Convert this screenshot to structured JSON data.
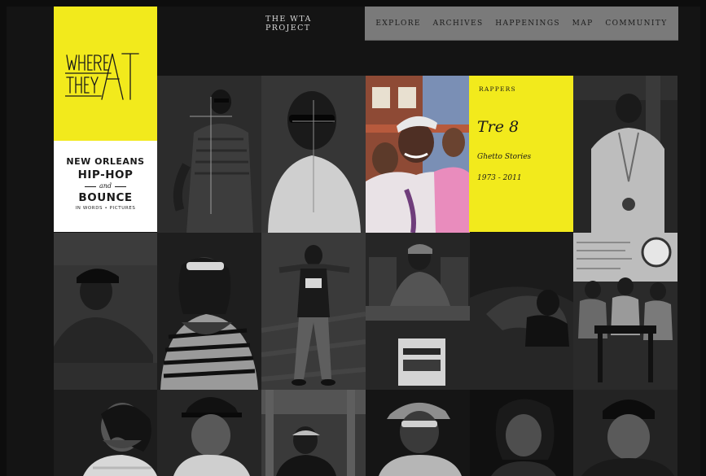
{
  "nav": {
    "project": "THE WTA PROJECT",
    "items": [
      "EXPLORE",
      "ARCHIVES",
      "HAPPENINGS",
      "MAP",
      "COMMUNITY"
    ]
  },
  "logo": {
    "line1": "NEW ORLEANS",
    "line2": "HIP-HOP",
    "and": "and",
    "line3": "BOUNCE",
    "small": "IN WORDS • PICTURES"
  },
  "feature": {
    "category": "RAPPERS",
    "name": "Tre 8",
    "subtitle": "Ghetto Stories",
    "years": "1973 - 2011"
  },
  "colors": {
    "accent_yellow": "#f2ea1c",
    "nav_gray": "#7a7a7a",
    "background": "#141414"
  }
}
